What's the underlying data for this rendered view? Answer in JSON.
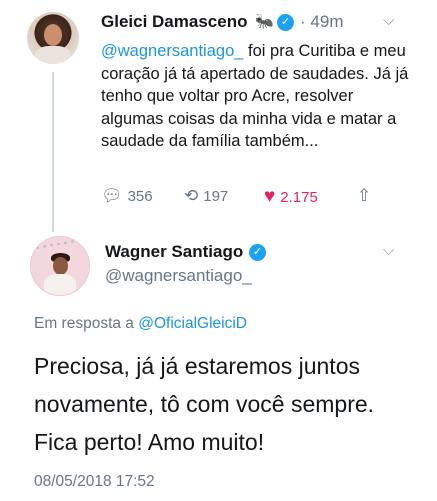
{
  "tweet1": {
    "author_name": "Gleici Damasceno",
    "author_emoji": "🐜",
    "time_sep": "·",
    "time": "49m",
    "text_mention": "@wagnersantiago_",
    "text_body": " foi pra Curitiba e meu coração já tá apertado de saudades. Já já tenho que voltar pro Acre, resolver algumas coisas da minha vida e matar a saudade da família também...",
    "replies": "356",
    "retweets": "197",
    "likes": "2.175"
  },
  "tweet2": {
    "author_name": "Wagner Santiago",
    "handle": "@wagnersantiago_",
    "reply_prefix": "Em resposta a ",
    "reply_to": "@OficialGleiciD",
    "text": "Preciosa, já já estaremos juntos novamente, tô com você sempre. Fica perto! Amo muito!",
    "timestamp": "08/05/2018 17:52"
  },
  "icons": {
    "verified": "verified-badge-icon",
    "chevron": "chevron-down-icon",
    "reply": "reply-icon",
    "retweet": "retweet-icon",
    "like": "heart-icon",
    "share": "share-icon"
  },
  "colors": {
    "link": "#1b95e0",
    "verified": "#1da1f2",
    "like": "#e0245e",
    "muted": "#657786"
  }
}
